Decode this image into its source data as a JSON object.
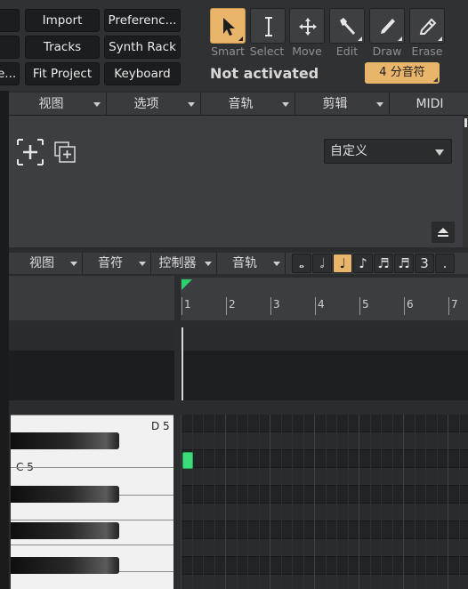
{
  "toolbar": {
    "buttons_col1": [
      "Import",
      "Tracks",
      "Fit Project"
    ],
    "buttons_col2": [
      "Preferenc...",
      "Synth Rack",
      "Keyboard"
    ],
    "cut_edge_label": "e...",
    "tools": [
      {
        "label": "Smart",
        "icon": "pointer-icon",
        "active": true
      },
      {
        "label": "Select",
        "icon": "ibeam-select-icon",
        "active": false
      },
      {
        "label": "Move",
        "icon": "move-arrows-icon",
        "active": false
      },
      {
        "label": "Edit",
        "icon": "edit-wrench-icon",
        "active": false
      },
      {
        "label": "Draw",
        "icon": "pencil-draw-icon",
        "active": false
      },
      {
        "label": "Erase",
        "icon": "eraser-icon",
        "active": false
      }
    ],
    "status_text": "Not activated",
    "quantize_value": "4 分音符"
  },
  "menubar": [
    "视图",
    "选项",
    "音轨",
    "剪辑",
    "MIDI"
  ],
  "track_panel": {
    "preset_value": "自定义"
  },
  "editor_bar": {
    "menus": [
      "视图",
      "音符",
      "控制器",
      "音轨"
    ],
    "note_buttons": [
      "𝅝",
      "𝅗𝅥",
      "♩",
      "♪",
      "♬",
      "♬",
      "3",
      "."
    ],
    "active_note_index": 2
  },
  "ruler": {
    "bars": [
      "1",
      "2",
      "3",
      "4",
      "5",
      "6",
      "7"
    ]
  },
  "piano": {
    "labels": [
      "D 5",
      "C 5"
    ]
  },
  "colors": {
    "accent": "#e9b56b",
    "note": "#3ddc7a",
    "panel": "#3d3e41"
  }
}
